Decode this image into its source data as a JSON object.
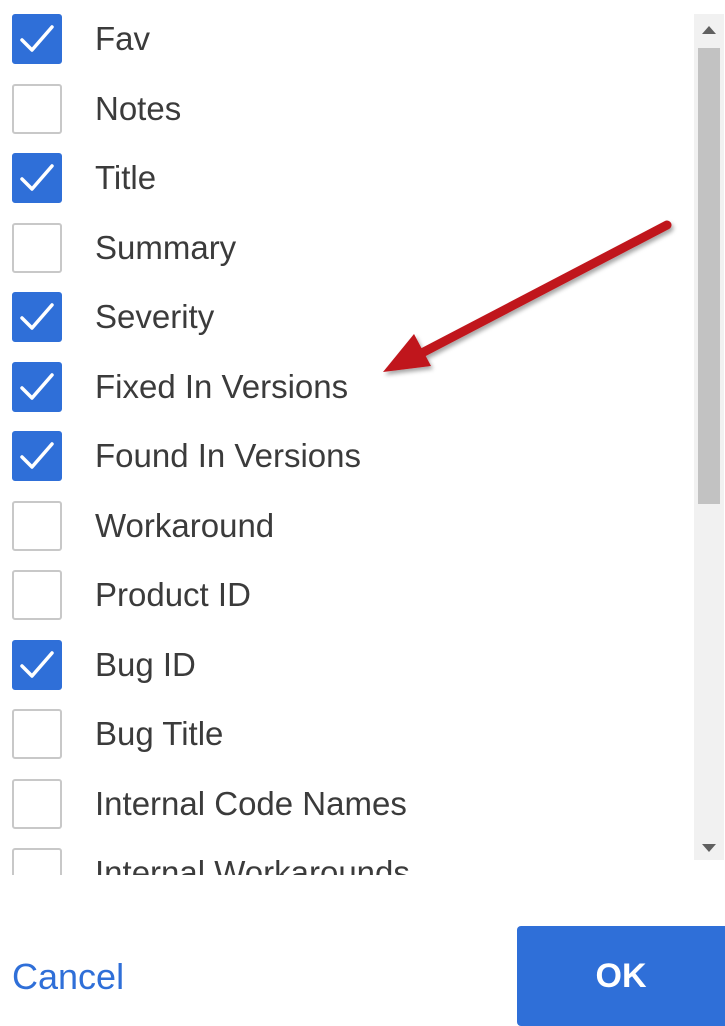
{
  "options": [
    {
      "label": "Fav",
      "checked": true
    },
    {
      "label": "Notes",
      "checked": false
    },
    {
      "label": "Title",
      "checked": true
    },
    {
      "label": "Summary",
      "checked": false
    },
    {
      "label": "Severity",
      "checked": true
    },
    {
      "label": "Fixed In Versions",
      "checked": true
    },
    {
      "label": "Found In Versions",
      "checked": true
    },
    {
      "label": "Workaround",
      "checked": false
    },
    {
      "label": "Product ID",
      "checked": false
    },
    {
      "label": "Bug ID",
      "checked": true
    },
    {
      "label": "Bug Title",
      "checked": false
    },
    {
      "label": "Internal Code Names",
      "checked": false
    },
    {
      "label": "Internal Workarounds",
      "checked": false
    }
  ],
  "footer": {
    "cancel_label": "Cancel",
    "ok_label": "OK"
  },
  "colors": {
    "accent": "#2f6fd8",
    "annotation_arrow": "#c0141c"
  }
}
